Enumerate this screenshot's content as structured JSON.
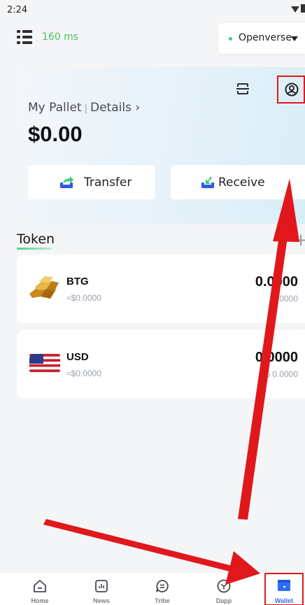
{
  "status_bar": {
    "time": "2:24"
  },
  "header": {
    "latency": "160 ms",
    "network": "Openverse"
  },
  "wallet": {
    "name": "My Pallet",
    "separator": "|",
    "details_link": "Details ›",
    "balance": "$0.00",
    "transfer_label": "Transfer",
    "receive_label": "Receive"
  },
  "tokens": {
    "heading": "Token",
    "add_symbol": "+",
    "items": [
      {
        "name": "BTG",
        "fiat_value": "≈$0.0000",
        "amount": "0.0000",
        "amount_fiat": "0.0000"
      },
      {
        "name": "USD",
        "fiat_value": "≈$0.0000",
        "amount": "0.0000",
        "amount_fiat": "$ 0.0000"
      }
    ]
  },
  "tab_bar": {
    "items": [
      {
        "label": "Home"
      },
      {
        "label": "News"
      },
      {
        "label": "Tribe"
      },
      {
        "label": "Dapp"
      },
      {
        "label": "Wallet"
      }
    ],
    "active": "Wallet"
  },
  "colors": {
    "latency_green": "#4cc15b",
    "accent_blue": "#2d6cf6",
    "annotation_red": "#e0181c",
    "card_gradient_end": "#d8eef6"
  }
}
